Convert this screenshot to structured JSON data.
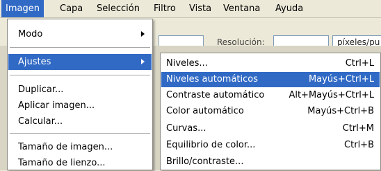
{
  "menubar": {
    "items": [
      "Imagen",
      "Capa",
      "Selección",
      "Filtro",
      "Vista",
      "Ventana",
      "Ayuda"
    ]
  },
  "options_bar": {
    "resolution_label": "Resolución:",
    "unit_select": "píxeles/pu"
  },
  "imagen_menu": {
    "items": [
      {
        "label": "Modo",
        "submenu": true
      },
      {
        "label": "Ajustes",
        "submenu": true,
        "highlighted": true
      },
      {
        "label": "Duplicar..."
      },
      {
        "label": "Aplicar imagen..."
      },
      {
        "label": "Calcular..."
      },
      {
        "label": "Tamaño de imagen..."
      },
      {
        "label": "Tamaño de lienzo..."
      }
    ]
  },
  "ajustes_submenu": {
    "items": [
      {
        "label": "Niveles...",
        "shortcut": "Ctrl+L"
      },
      {
        "label": "Niveles automáticos",
        "shortcut": "Mayús+Ctrl+L",
        "highlighted": true
      },
      {
        "label": "Contraste automático",
        "shortcut": "Alt+Mayús+Ctrl+L"
      },
      {
        "label": "Color automático",
        "shortcut": "Mayús+Ctrl+B"
      },
      {
        "label": "Curvas...",
        "shortcut": "Ctrl+M"
      },
      {
        "label": "Equilibrio de color...",
        "shortcut": "Ctrl+B"
      },
      {
        "label": "Brillo/contraste...",
        "shortcut": ""
      }
    ]
  },
  "colors": {
    "highlight": "#316ac5",
    "menu_bg": "#ffffff",
    "chrome_bg": "#ece9d8"
  }
}
